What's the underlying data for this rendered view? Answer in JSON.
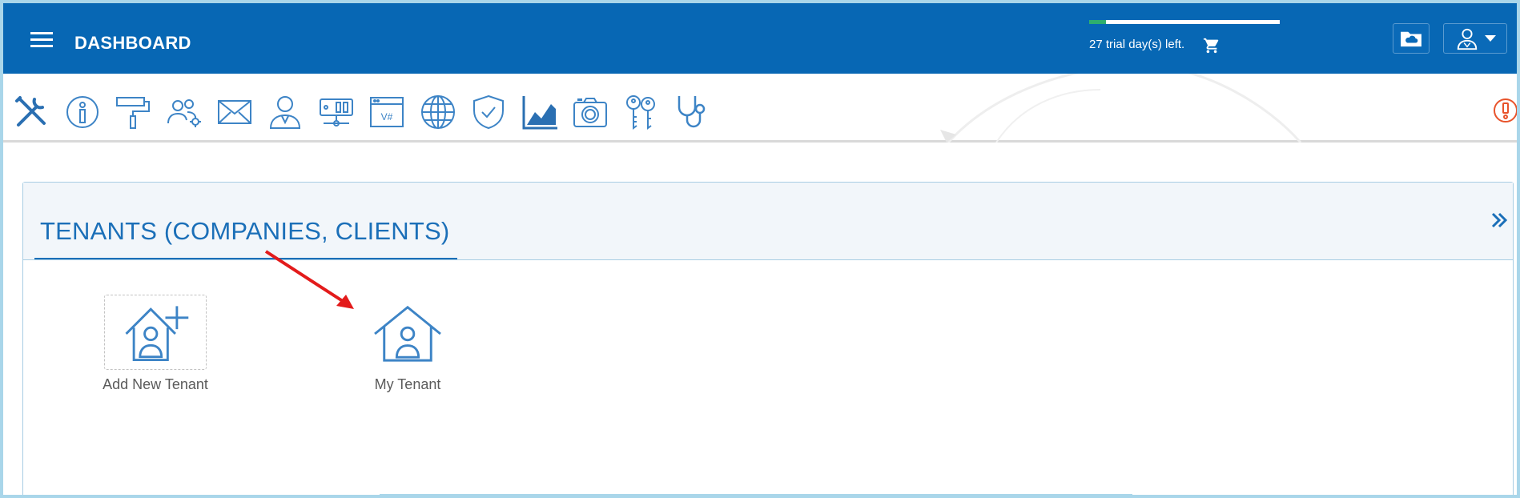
{
  "header": {
    "title": "DASHBOARD",
    "trial_text": "27 trial day(s) left.",
    "trial_progress": 0.09
  },
  "toolbar": {
    "icons": [
      "tools-icon",
      "info-icon",
      "paint-roller-icon",
      "user-group-settings-icon",
      "mail-icon",
      "user-tie-icon",
      "server-icon",
      "vsharp-code-icon",
      "globe-icon",
      "shield-check-icon",
      "chart-icon",
      "camera-icon",
      "keys-icon",
      "stethoscope-icon"
    ],
    "alert_icon": "alert-icon"
  },
  "panel": {
    "title": "TENANTS (COMPANIES, CLIENTS)",
    "tiles": [
      {
        "label": "Add New Tenant",
        "icon": "house-user-add-icon"
      },
      {
        "label": "My Tenant",
        "icon": "house-user-icon"
      }
    ]
  },
  "colors": {
    "header_bg": "#0767b4",
    "accent": "#1b6fb8",
    "icon_blue": "#3d84c6",
    "progress_green": "#2eae6e",
    "annotation_red": "#e31b1b"
  }
}
